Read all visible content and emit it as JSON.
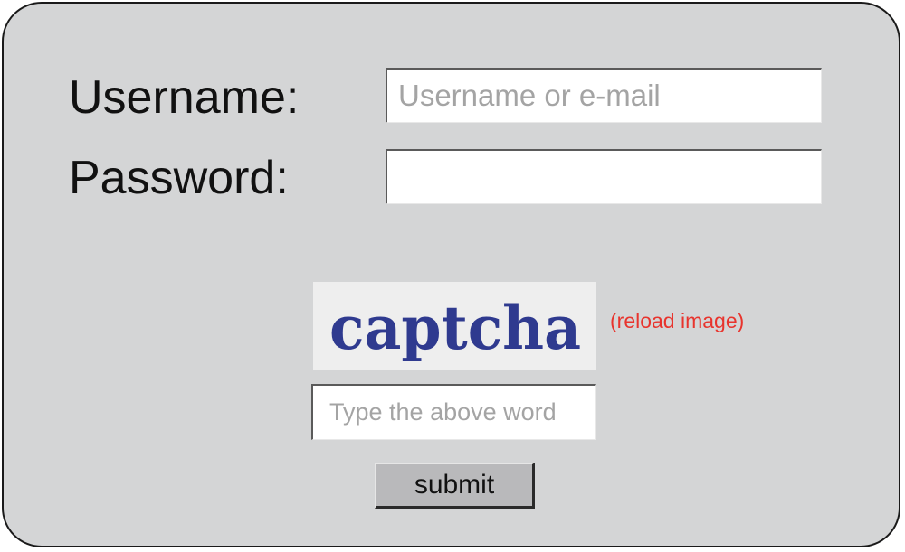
{
  "form": {
    "username_label": "Username:",
    "username_placeholder": "Username or e-mail",
    "password_label": "Password:",
    "password_value": ""
  },
  "captcha": {
    "image_text": "captcha",
    "image_text_color": "#2f3a8f",
    "reload_label": "(reload image)",
    "reload_color": "#e8342d",
    "input_placeholder": "Type the above word"
  },
  "actions": {
    "submit_label": "submit"
  }
}
